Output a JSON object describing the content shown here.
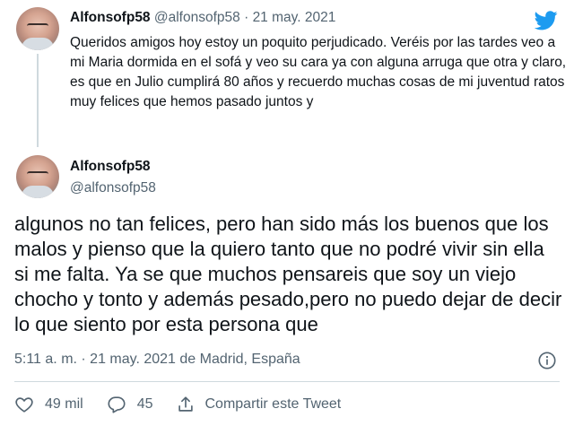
{
  "parent_tweet": {
    "display_name": "Alfonsofp58",
    "handle": "@alfonsofp58",
    "separator": "·",
    "date": "21 may. 2021",
    "text": "Queridos amigos hoy estoy un poquito perjudicado. Veréis por las tardes veo a mi Maria dormida en el sofá y veo su cara ya con alguna arruga que otra y claro, es que en Julio cumplirá 80  años y recuerdo muchas cosas de mi juventud ratos muy felices que hemos pasado juntos y"
  },
  "main_tweet": {
    "display_name": "Alfonsofp58",
    "handle": "@alfonsofp58",
    "text": "algunos no tan felices, pero han sido más los buenos que los malos y pienso que la quiero tanto que no podré vivir sin ella si me falta. Ya se que muchos pensareis que soy un viejo chocho y tonto y además pesado,pero no puedo dejar de decir lo que siento por esta persona que",
    "timestamp": "5:11 a. m. · 21 may. 2021 de Madrid, España"
  },
  "actions": {
    "likes": "49 mil",
    "replies": "45",
    "share_label": "Compartir este Tweet"
  },
  "icons": {
    "logo": "twitter-bird-icon",
    "info": "info-icon",
    "like": "heart-icon",
    "reply": "comment-icon",
    "share": "share-icon"
  },
  "colors": {
    "brand": "#1d9bf0",
    "text": "#0f1419",
    "secondary": "#536471",
    "divider": "#cfd9de"
  }
}
